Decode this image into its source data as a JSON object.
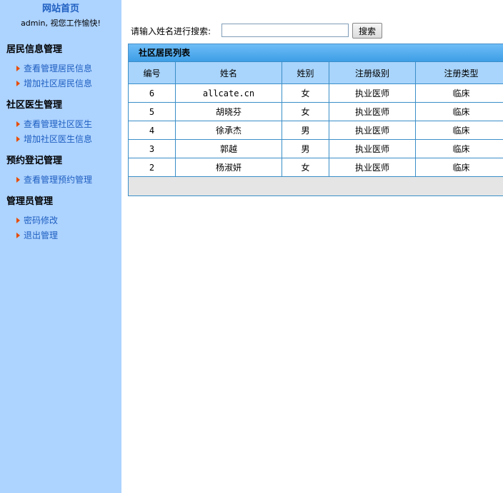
{
  "sidebar": {
    "home_link": "网站首页",
    "welcome": "admin, 视您工作愉快!",
    "sections": [
      {
        "title": "居民信息管理",
        "items": [
          "查看管理居民信息",
          "增加社区居民信息"
        ]
      },
      {
        "title": "社区医生管理",
        "items": [
          "查看管理社区医生",
          "增加社区医生信息"
        ]
      },
      {
        "title": "预约登记管理",
        "items": [
          "查看管理预约管理"
        ]
      },
      {
        "title": "管理员管理",
        "items": [
          "密码修改",
          "退出管理"
        ]
      }
    ]
  },
  "search": {
    "label": "请输入姓名进行搜索:",
    "value": "",
    "button_label": "搜索"
  },
  "panel": {
    "title": "社区居民列表",
    "columns": [
      "编号",
      "姓名",
      "姓别",
      "注册级别",
      "注册类型"
    ],
    "rows": [
      [
        "6",
        "allcate.cn",
        "女",
        "执业医师",
        "临床"
      ],
      [
        "5",
        "胡晓芬",
        "女",
        "执业医师",
        "临床"
      ],
      [
        "4",
        "徐承杰",
        "男",
        "执业医师",
        "临床"
      ],
      [
        "3",
        "郭越",
        "男",
        "执业医师",
        "临床"
      ],
      [
        "2",
        "杨淑妍",
        "女",
        "执业医师",
        "临床"
      ]
    ]
  },
  "colors": {
    "sidebar_bg": "#add3ff",
    "link": "#1f5fc0",
    "header_gradient": "#3e9ee6",
    "table_header_bg": "#a9d4fb",
    "border": "#3a8ec8",
    "arrow": "#e84b00"
  },
  "icons": {
    "menu_bullet": "arrow-right-icon"
  }
}
